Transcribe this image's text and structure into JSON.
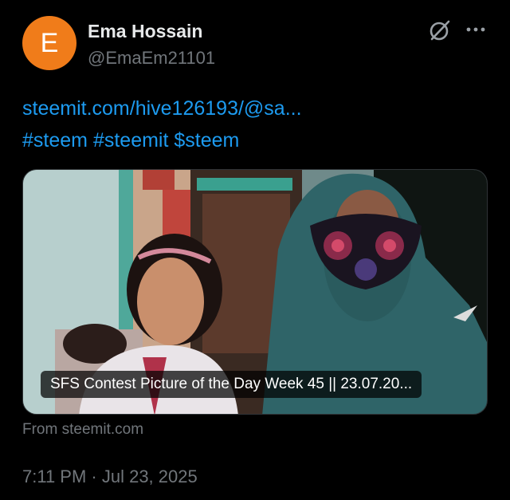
{
  "author": {
    "avatar_initial": "E",
    "avatar_color": "#f07c1a",
    "name": "Ema Hossain",
    "handle": "@EmaEm21101"
  },
  "header_icons": [
    "grok-icon",
    "more-icon"
  ],
  "body": {
    "link": "steemit.com/hive126193/@sa...",
    "hashtags": [
      "#steem",
      "#steemit",
      "$steem"
    ]
  },
  "card": {
    "title": "SFS Contest Picture of the Day Week 45 || 23.07.20...",
    "source": "From steemit.com"
  },
  "timestamp": "7:11 PM · Jul 23, 2025",
  "colors": {
    "background": "#000000",
    "link": "#1d9bf0",
    "secondary_text": "#71767b",
    "primary_text": "#e7e9ea"
  }
}
